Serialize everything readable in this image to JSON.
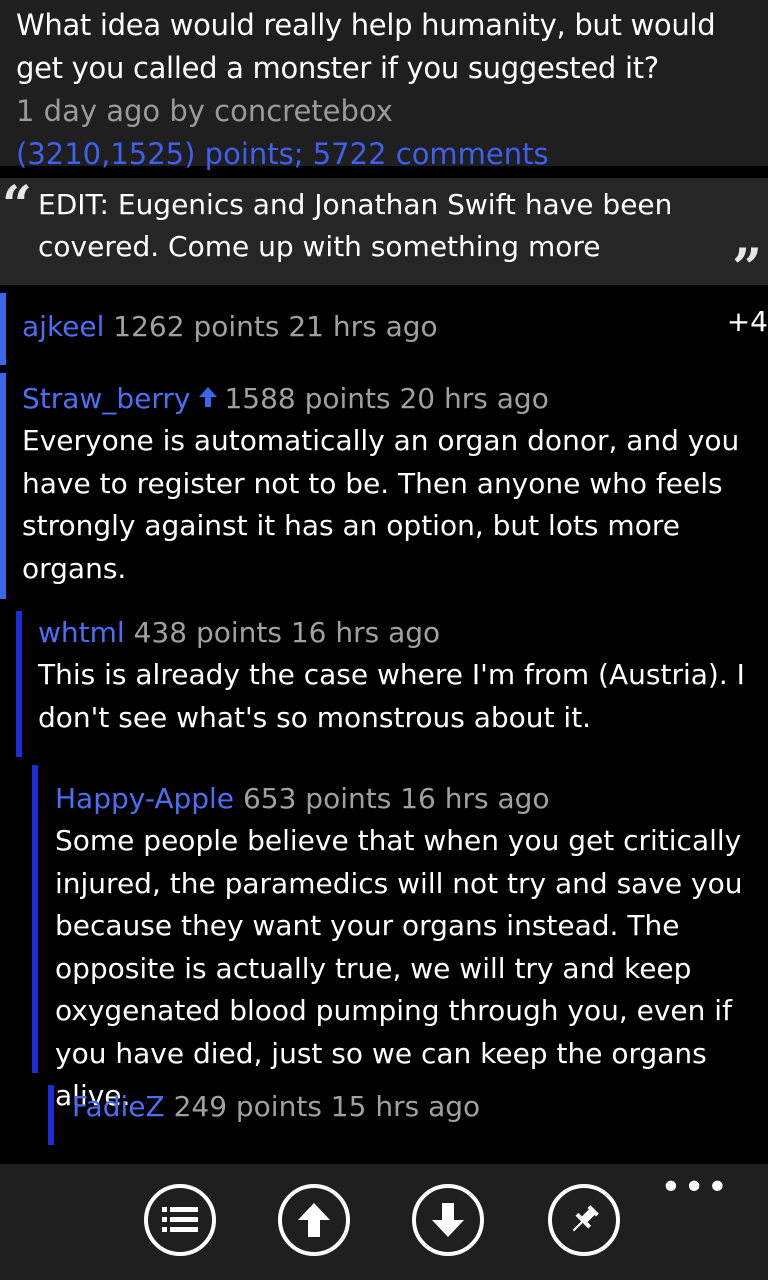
{
  "post": {
    "title": "What idea would really help humanity, but would get you called a monster if you suggested it?",
    "meta": "1 day ago by concretebox",
    "stats": "(3210,1525) points; 5722 comments"
  },
  "selftext": {
    "open_quote": "“",
    "close_quote": "”",
    "body": "EDIT: Eugenics and Jonathan Swift have been covered. Come up with something more"
  },
  "comments": [
    {
      "author": "ajkeel",
      "points_time": "1262 points 21 hrs ago",
      "expand_label": "+4",
      "text": ""
    },
    {
      "author": "Straw_berry",
      "points_time": "1588 points 20 hrs ago",
      "text": "Everyone is automatically an organ donor, and you have to register not to be. Then anyone who feels strongly against it has an option, but lots more organs."
    },
    {
      "author": "whtml",
      "points_time": "438 points 16 hrs ago",
      "text": "This is already the case where I'm from (Austria). I don't see what's so monstrous about it."
    },
    {
      "author": "Happy-Apple",
      "points_time": "653 points 16 hrs ago",
      "text": "Some people believe that when you get critically injured, the paramedics will not try and save you because they want your organs instead. The opposite is actually true, we will try and keep oxygenated blood pumping through you, even if you have died, just so we can keep the organs alive."
    },
    {
      "author": "FadieZ",
      "points_time": "249 points 15 hrs ago",
      "text": ""
    }
  ],
  "appbar": {
    "more_label": "•••",
    "icons": [
      "list-icon",
      "upvote-icon",
      "downvote-icon",
      "pin-icon"
    ]
  },
  "colors": {
    "accent": "#3c67e8",
    "nested_bar": "#1a2fd6",
    "author": "#4a6ff5",
    "header_bg": "#1f1f1f"
  }
}
